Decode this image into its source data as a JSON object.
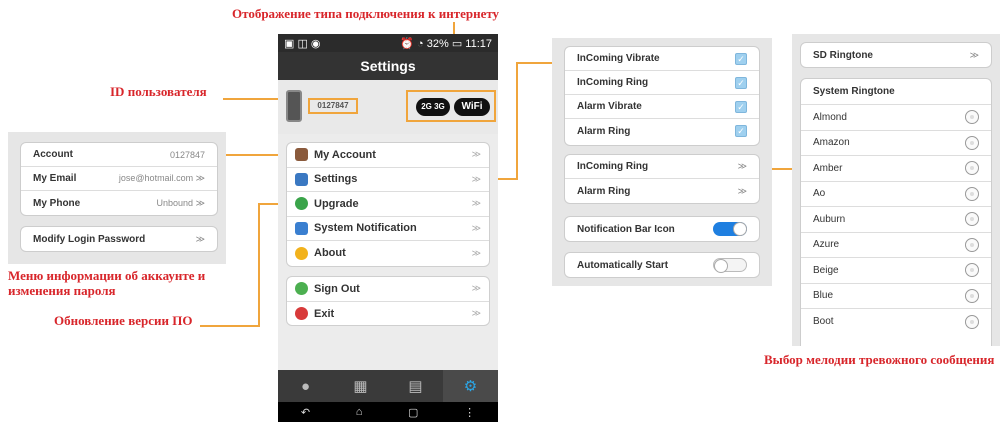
{
  "annotations": {
    "connection_type": "Отображение типа подключения к интернету",
    "user_id": "ID пользователя",
    "account_menu": "Меню информации об аккаунте и изменения пароля",
    "upgrade": "Обновление версии ПО",
    "alarm_melody": "Выбор мелодии тревожного сообщения"
  },
  "phone": {
    "status_time": "11:17",
    "status_battery": "32%",
    "title": "Settings",
    "user_id": "0127847",
    "net_badge_1": "2G 3G",
    "net_badge_2": "WiFi",
    "menu1": [
      {
        "label": "My Account",
        "icon": "user-icon",
        "color": "#8a5a3c"
      },
      {
        "label": "Settings",
        "icon": "settings-icon",
        "color": "#3a78c2"
      },
      {
        "label": "Upgrade",
        "icon": "upgrade-icon",
        "color": "#3aa44a"
      },
      {
        "label": "System Notification",
        "icon": "notification-icon",
        "color": "#3a7fd0"
      },
      {
        "label": "About",
        "icon": "star-icon",
        "color": "#f2b21c"
      }
    ],
    "menu2": [
      {
        "label": "Sign Out",
        "icon": "signout-icon",
        "color": "#4caf50"
      },
      {
        "label": "Exit",
        "icon": "exit-icon",
        "color": "#d83a3a"
      }
    ],
    "chevron": "≫"
  },
  "account_panel": {
    "rows": [
      {
        "label": "Account",
        "value": "0127847"
      },
      {
        "label": "My Email",
        "value": "jose@hotmail.com  ≫"
      },
      {
        "label": "My Phone",
        "value": "Unbound  ≫"
      }
    ],
    "modify": "Modify Login Password",
    "modify_chevron": "≫"
  },
  "settings_panel": {
    "checks": [
      "InComing Vibrate",
      "InComing Ring",
      "Alarm Vibrate",
      "Alarm Ring"
    ],
    "rings": [
      "InComing Ring",
      "Alarm Ring"
    ],
    "ring_chevron": "≫",
    "notification_bar": "Notification Bar Icon",
    "auto_start": "Automatically Start"
  },
  "ringtone_panel": {
    "sd": "SD Ringtone",
    "sd_chevron": "≫",
    "header": "System Ringtone",
    "items": [
      "Almond",
      "Amazon",
      "Amber",
      "Ao",
      "Auburn",
      "Azure",
      "Beige",
      "Blue",
      "Boot"
    ]
  }
}
